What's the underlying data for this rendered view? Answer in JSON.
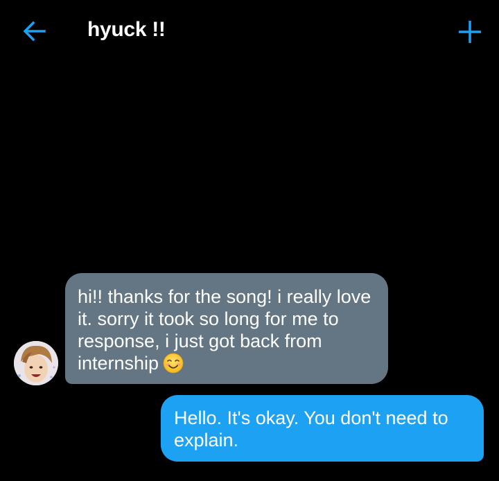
{
  "header": {
    "title": "hyuck !!",
    "back_icon": "arrow-left-icon",
    "new_icon": "plus-icon",
    "accent_color": "#1da1f2"
  },
  "messages": [
    {
      "direction": "incoming",
      "text": "hi!! thanks for the song! i really love it. sorry it took so long for me to response, i just got back from internship",
      "emoji": "smiling-face-icon",
      "bubble_color": "#647583"
    },
    {
      "direction": "outgoing",
      "text": "Hello. It's okay. You don't need to explain.",
      "bubble_color": "#1da1f2"
    }
  ]
}
